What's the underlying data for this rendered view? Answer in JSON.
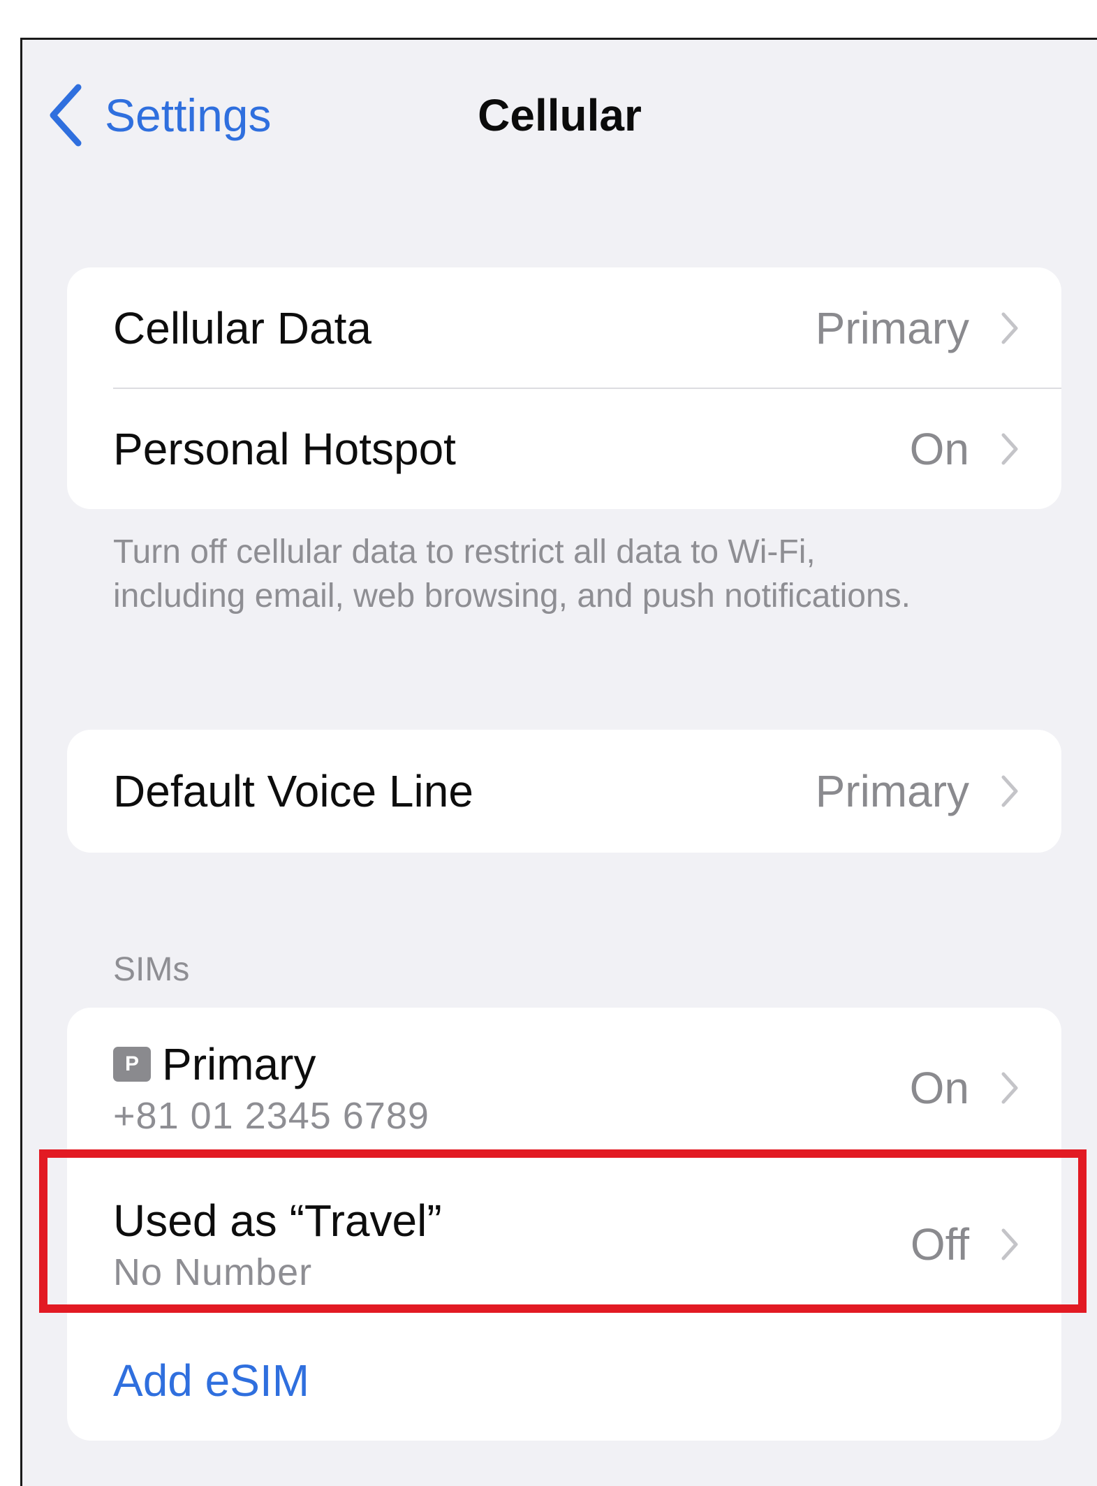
{
  "nav": {
    "back_label": "Settings",
    "title": "Cellular"
  },
  "group1": {
    "rows": [
      {
        "label": "Cellular Data",
        "value": "Primary"
      },
      {
        "label": "Personal Hotspot",
        "value": "On"
      }
    ],
    "footnote": "Turn off cellular data to restrict all data to Wi-Fi, including email, web browsing, and push notifications."
  },
  "group2": {
    "rows": [
      {
        "label": "Default Voice Line",
        "value": "Primary"
      }
    ]
  },
  "sims": {
    "header": "SIMs",
    "items": [
      {
        "badge": "P",
        "title": "Primary",
        "subtitle": "+81 01 2345 6789",
        "value": "On"
      },
      {
        "title": "Used as “Travel”",
        "subtitle": "No Number",
        "value": "Off"
      }
    ],
    "add_label": "Add eSIM"
  },
  "colors": {
    "accent": "#2f6fde",
    "highlight": "#e21a23",
    "background": "#f1f1f5"
  }
}
